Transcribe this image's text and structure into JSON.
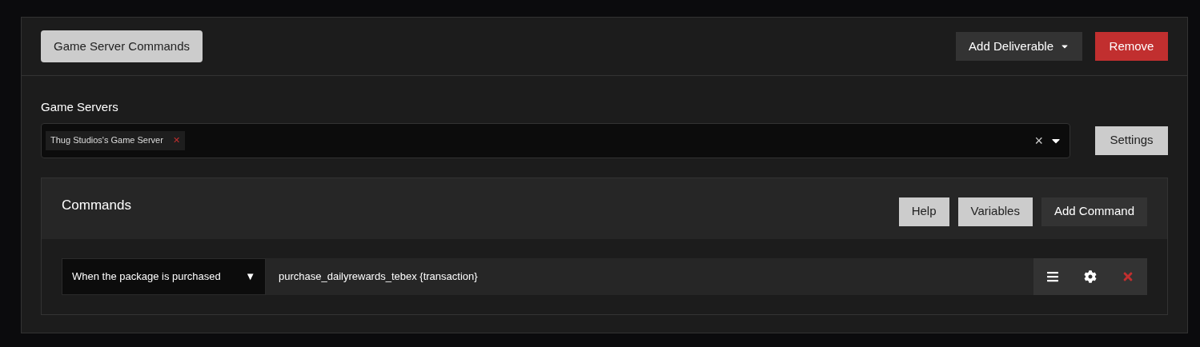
{
  "header": {
    "title_button": "Game Server Commands",
    "add_button": "Add Deliverable",
    "remove_button": "Remove"
  },
  "game_servers": {
    "label": "Game Servers",
    "tags": [
      {
        "label": "Thug Studios's Game Server",
        "remove": "✕"
      }
    ],
    "clear": "×",
    "settings_button": "Settings"
  },
  "commands": {
    "title": "Commands",
    "buttons": [
      {
        "label": "Help",
        "kind": "light"
      },
      {
        "label": "Variables",
        "kind": "light"
      },
      {
        "label": "Add Command",
        "kind": "dark"
      }
    ],
    "rows": [
      {
        "trigger": "When the package is purchased",
        "caret": "▼",
        "command": "purchase_dailyrewards_tebex {transaction}"
      }
    ]
  }
}
